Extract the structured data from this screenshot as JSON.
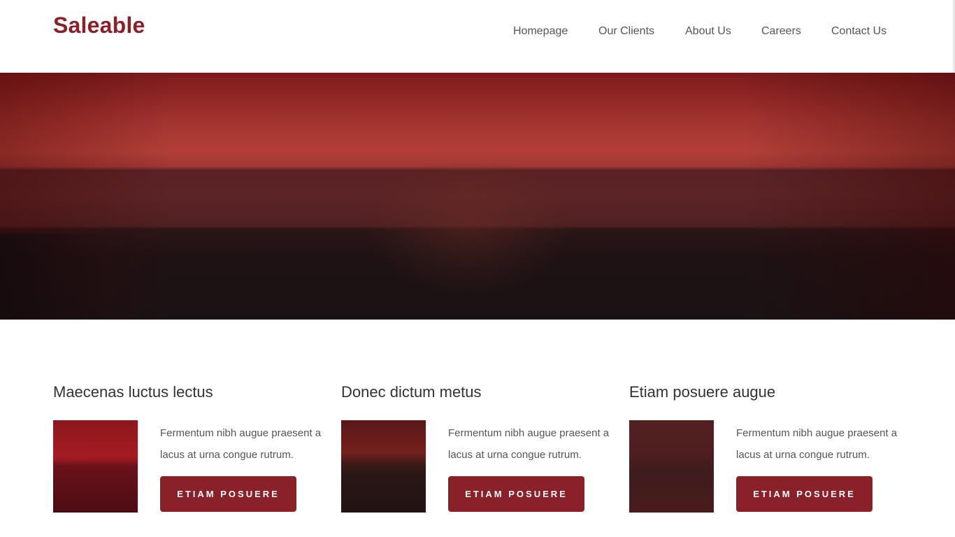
{
  "header": {
    "logo": "Saleable",
    "nav": [
      "Homepage",
      "Our Clients",
      "About Us",
      "Careers",
      "Contact Us"
    ]
  },
  "features": [
    {
      "title": "Maecenas luctus lectus",
      "text": "Fermentum nibh augue praesent a lacus at urna congue rutrum.",
      "button": "ETIAM POSUERE"
    },
    {
      "title": "Donec dictum metus",
      "text": "Fermentum nibh augue praesent a lacus at urna congue rutrum.",
      "button": "ETIAM POSUERE"
    },
    {
      "title": "Etiam posuere augue",
      "text": "Fermentum nibh augue praesent a lacus at urna congue rutrum.",
      "button": "ETIAM POSUERE"
    }
  ],
  "colors": {
    "accent": "#8a2128"
  }
}
